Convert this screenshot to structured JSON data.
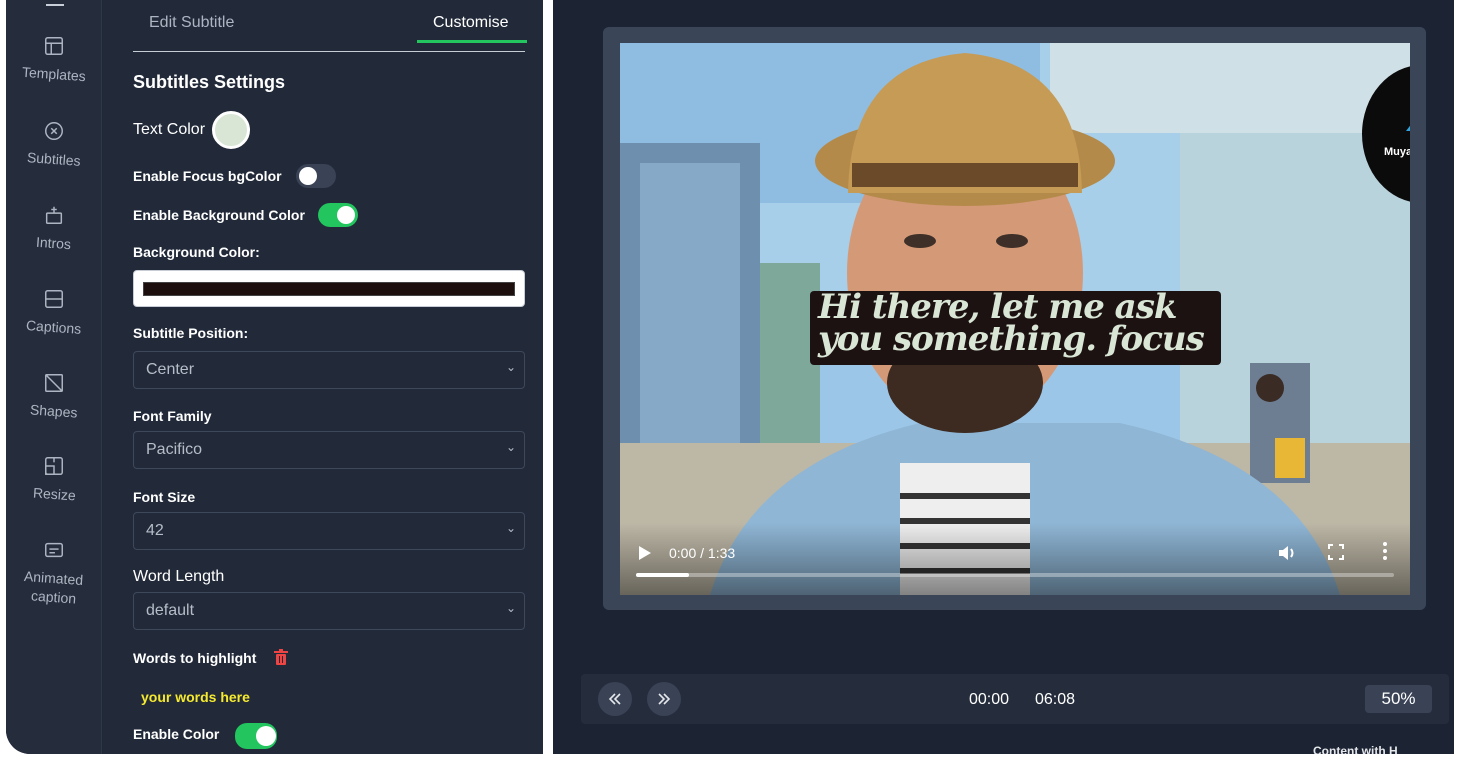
{
  "sidebar": {
    "items": [
      {
        "label": "Templates",
        "icon": "template-icon"
      },
      {
        "label": "Subtitles",
        "icon": "subtitles-icon"
      },
      {
        "label": "Intros",
        "icon": "intros-icon"
      },
      {
        "label": "Captions",
        "icon": "captions-icon"
      },
      {
        "label": "Shapes",
        "icon": "shapes-icon"
      },
      {
        "label": "Resize",
        "icon": "resize-icon"
      },
      {
        "label": "Animated",
        "label2": "caption",
        "icon": "animated-caption-icon"
      }
    ]
  },
  "tabs": {
    "edit": "Edit Subtitle",
    "customise": "Customise",
    "active": "customise"
  },
  "settings": {
    "title": "Subtitles Settings",
    "text_color_label": "Text Color",
    "text_color": "#d9e6d6",
    "focus_bg_label": "Enable Focus bgColor",
    "focus_bg_enabled": false,
    "bg_color_enable_label": "Enable Background Color",
    "bg_color_enabled": true,
    "bg_color_label": "Background Color:",
    "bg_color": "#1e0f0f",
    "position_label": "Subtitle Position:",
    "position_value": "Center",
    "font_family_label": "Font Family",
    "font_family_value": "Pacifico",
    "font_size_label": "Font Size",
    "font_size_value": "42",
    "word_length_label": "Word Length",
    "word_length_value": "default",
    "highlight_label": "Words to highlight",
    "highlight_placeholder": "your words here",
    "enable_color_label": "Enable Color",
    "enable_color_enabled": true
  },
  "preview": {
    "subtitle_line1": "Hi there, let me ask",
    "subtitle_line2": "you something. focus",
    "logo_text": "Muyas C",
    "time": "0:00 / 1:33",
    "progress": 0.07
  },
  "timeline": {
    "current": "00:00",
    "total": "06:08",
    "zoom": "50%",
    "bottom_text": "Content with H"
  },
  "colors": {
    "accent": "#22c55e",
    "trash": "#ef4444",
    "highlight": "#f5ea2e"
  }
}
